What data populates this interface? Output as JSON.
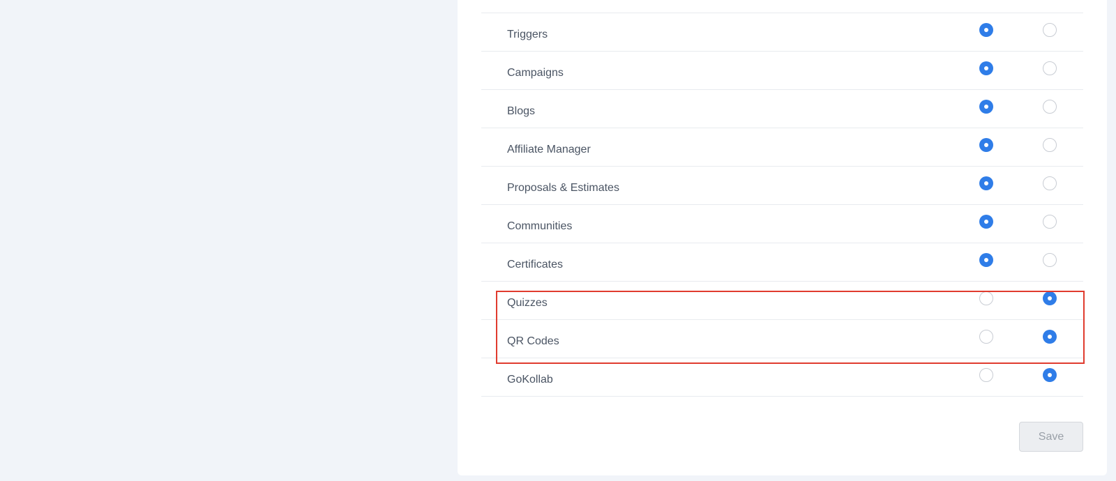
{
  "permissions": {
    "rows": [
      {
        "label": "",
        "enabled": true
      },
      {
        "label": "Triggers",
        "enabled": true
      },
      {
        "label": "Campaigns",
        "enabled": true
      },
      {
        "label": "Blogs",
        "enabled": true
      },
      {
        "label": "Affiliate Manager",
        "enabled": true
      },
      {
        "label": "Proposals & Estimates",
        "enabled": true
      },
      {
        "label": "Communities",
        "enabled": true
      },
      {
        "label": "Certificates",
        "enabled": true
      },
      {
        "label": "Quizzes",
        "enabled": false
      },
      {
        "label": "QR Codes",
        "enabled": false
      },
      {
        "label": "GoKollab",
        "enabled": false
      }
    ]
  },
  "footer": {
    "save_label": "Save"
  },
  "colors": {
    "background": "#f1f4f9",
    "panel": "#ffffff",
    "radio_checked": "#2f7de8",
    "highlight": "#e03b2e"
  }
}
